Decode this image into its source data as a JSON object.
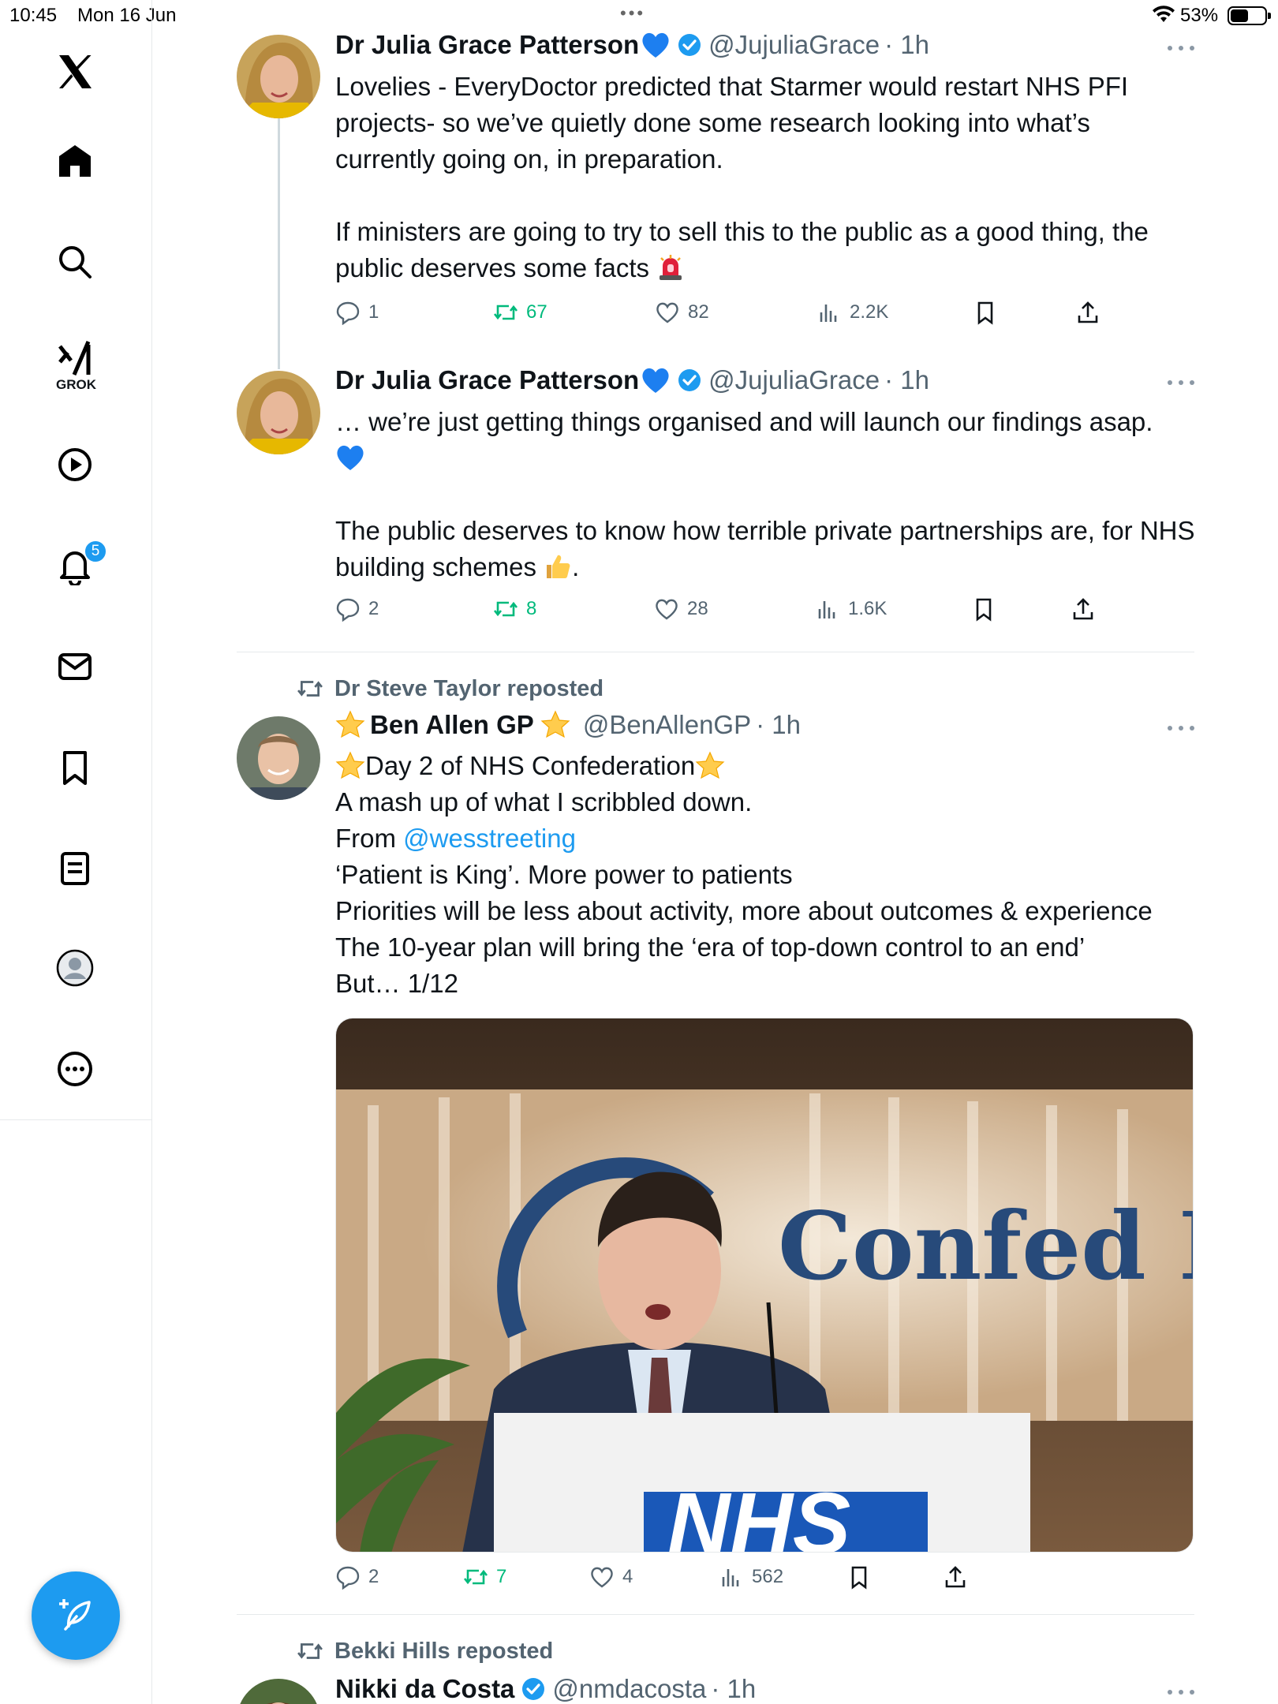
{
  "status_bar": {
    "time": "10:45",
    "date": "Mon 16 Jun",
    "battery": "53%",
    "battery_level": 0.53
  },
  "sidebar": {
    "grok_label": "GROK",
    "notifications_badge": "5",
    "items": [
      "x-logo",
      "home-icon",
      "search-icon",
      "grok-icon",
      "video-icon",
      "bell-icon",
      "mail-icon",
      "bookmark-icon",
      "list-icon",
      "profile-icon",
      "more-icon"
    ]
  },
  "tweets": [
    {
      "name": "Dr Julia Grace Patterson",
      "handle": "@JujuliaGrace",
      "time": "· 1h",
      "paragraphs": [
        "Lovelies - EveryDoctor predicted that Starmer would restart NHS PFI projects- so we’ve quietly done some research looking into what’s currently going on, in preparation.",
        "If ministers are going to try to sell this to the public as a good thing, the public deserves some facts"
      ],
      "replies": "1",
      "reposts": "67",
      "likes": "82",
      "views": "2.2K"
    },
    {
      "name": "Dr Julia Grace Patterson",
      "handle": "@JujuliaGrace",
      "time": "· 1h",
      "paragraphs": [
        "… we’re just getting things organised and will launch our findings asap.",
        "The public deserves to know how terrible private partnerships are, for NHS building schemes",
        "."
      ],
      "replies": "2",
      "reposts": "8",
      "likes": "28",
      "views": "1.6K"
    },
    {
      "reposted_by": "Dr Steve Taylor reposted",
      "name": "Ben Allen GP",
      "handle": "@BenAllenGP",
      "time": "· 1h",
      "lines": [
        "Day 2 of NHS Confederation",
        "A mash up of what I scribbled down.",
        "From ",
        "@wesstreeting",
        "‘Patient is King’. More power to patients",
        "Priorities will be less about activity, more about outcomes & experience",
        "The 10-year plan will bring the ‘era of top-down control to an end’",
        "But… 1/12"
      ],
      "media": {
        "sign_text": "Confed Expo",
        "podium_text": "NHS"
      },
      "replies": "2",
      "reposts": "7",
      "likes": "4",
      "views": "562"
    },
    {
      "reposted_by": "Bekki Hills reposted",
      "name": "Nikki da Costa",
      "handle": "@nmdacosta",
      "time": "· 1h"
    }
  ],
  "colors": {
    "accent": "#1d9bf0",
    "repost_green": "#00ba7c",
    "muted": "#536471",
    "text": "#0f1419"
  }
}
